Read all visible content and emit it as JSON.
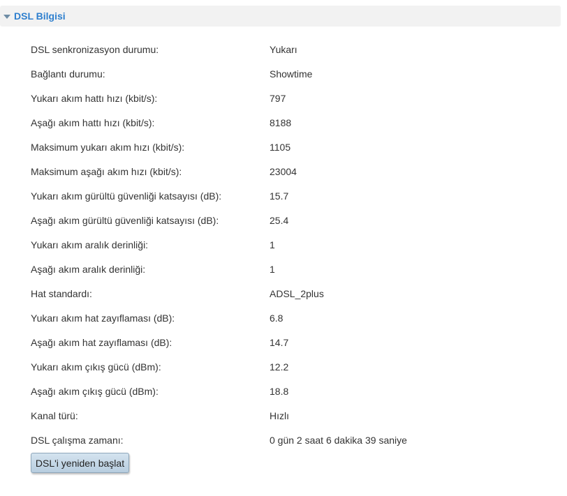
{
  "section": {
    "title": "DSL Bilgisi",
    "toggle_icon": "triangle-down-icon"
  },
  "rows": [
    {
      "label": "DSL senkronizasyon durumu:",
      "value": "Yukarı"
    },
    {
      "label": "Bağlantı durumu:",
      "value": "Showtime"
    },
    {
      "label": "Yukarı akım hattı hızı (kbit/s):",
      "value": "797"
    },
    {
      "label": "Aşağı akım hattı hızı (kbit/s):",
      "value": "8188"
    },
    {
      "label": "Maksimum yukarı akım hızı (kbit/s):",
      "value": "1105"
    },
    {
      "label": "Maksimum aşağı akım hızı (kbit/s):",
      "value": "23004"
    },
    {
      "label": "Yukarı akım gürültü güvenliği katsayısı (dB):",
      "value": "15.7"
    },
    {
      "label": "Aşağı akım gürültü güvenliği katsayısı (dB):",
      "value": "25.4"
    },
    {
      "label": "Yukarı akım aralık derinliği:",
      "value": "1"
    },
    {
      "label": "Aşağı akım aralık derinliği:",
      "value": "1"
    },
    {
      "label": "Hat standardı:",
      "value": "ADSL_2plus"
    },
    {
      "label": "Yukarı akım hat zayıflaması (dB):",
      "value": "6.8"
    },
    {
      "label": "Aşağı akım hat zayıflaması (dB):",
      "value": "14.7"
    },
    {
      "label": "Yukarı akım çıkış gücü (dBm):",
      "value": "12.2"
    },
    {
      "label": "Aşağı akım çıkış gücü (dBm):",
      "value": "18.8"
    },
    {
      "label": "Kanal türü:",
      "value": "Hızlı"
    },
    {
      "label": "DSL çalışma zamanı:",
      "value": "0 gün 2 saat 6 dakika 39 saniye"
    }
  ],
  "actions": {
    "restart_label": "DSL'i yeniden başlat"
  },
  "colors": {
    "title": "#2e7fce",
    "header_bg": "#f2f2f2",
    "text": "#333333",
    "button_bg": "#c5d8e8"
  }
}
